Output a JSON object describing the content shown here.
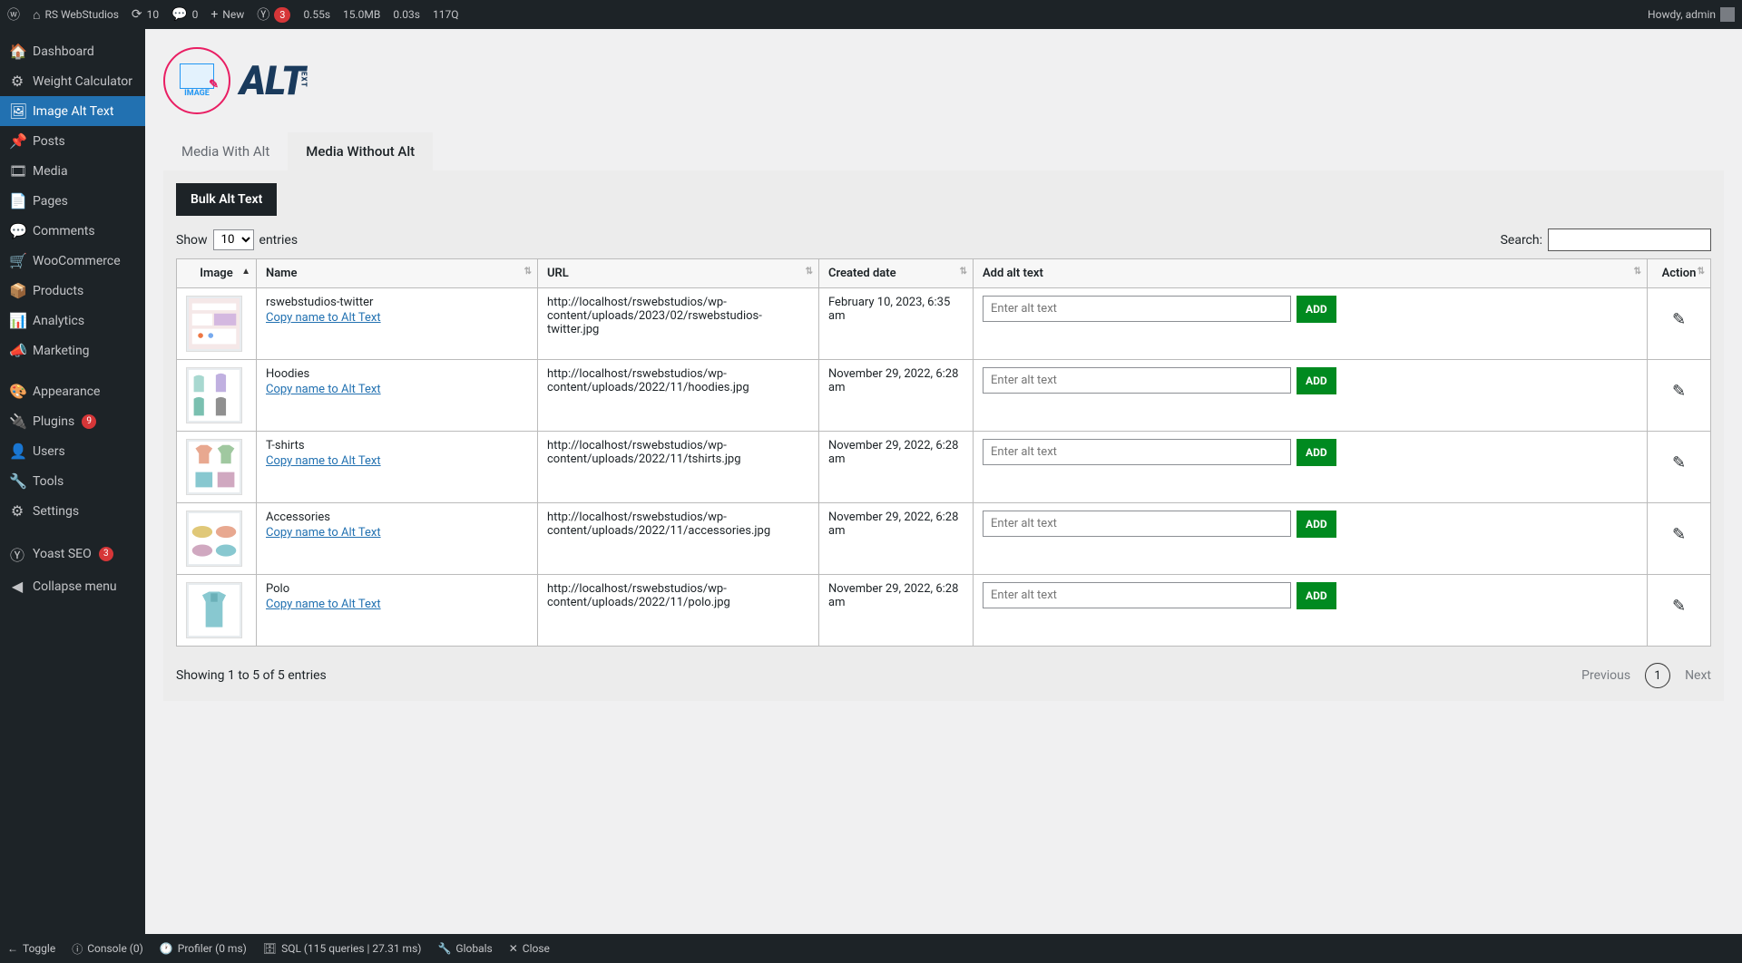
{
  "adminBar": {
    "siteName": "RS WebStudios",
    "refreshCount": "10",
    "commentsCount": "0",
    "newLabel": "New",
    "yoastBadge": "3",
    "perfTime1": "0.55s",
    "perfMem": "15.0MB",
    "perfTime2": "0.03s",
    "perfQ": "117Q",
    "greeting": "Howdy, admin"
  },
  "sidebar": {
    "items": [
      {
        "icon": "speedometer-icon",
        "label": "Dashboard"
      },
      {
        "icon": "gear-icon",
        "label": "Weight Calculator"
      },
      {
        "icon": "image-icon",
        "label": "Image Alt Text",
        "active": true
      },
      {
        "icon": "pin-icon",
        "label": "Posts"
      },
      {
        "icon": "media-icon",
        "label": "Media"
      },
      {
        "icon": "page-icon",
        "label": "Pages"
      },
      {
        "icon": "comment-icon",
        "label": "Comments"
      },
      {
        "icon": "woo-icon",
        "label": "WooCommerce"
      },
      {
        "icon": "product-icon",
        "label": "Products"
      },
      {
        "icon": "analytics-icon",
        "label": "Analytics"
      },
      {
        "icon": "megaphone-icon",
        "label": "Marketing"
      },
      {
        "icon": "brush-icon",
        "label": "Appearance"
      },
      {
        "icon": "plugin-icon",
        "label": "Plugins",
        "badge": "9"
      },
      {
        "icon": "user-icon",
        "label": "Users"
      },
      {
        "icon": "wrench-icon",
        "label": "Tools"
      },
      {
        "icon": "sliders-icon",
        "label": "Settings"
      },
      {
        "icon": "yoast-icon",
        "label": "Yoast SEO",
        "badge": "3"
      },
      {
        "icon": "collapse-icon",
        "label": "Collapse menu"
      }
    ]
  },
  "logo": {
    "circleText": "IMAGE",
    "mainText": "ALT",
    "subText": "TEXT"
  },
  "tabs": {
    "withAlt": "Media With Alt",
    "withoutAlt": "Media Without Alt"
  },
  "bulkBtn": "Bulk Alt Text",
  "controls": {
    "showLabel": "Show",
    "showValue": "10",
    "entriesLabel": "entries",
    "searchLabel": "Search:"
  },
  "columns": {
    "image": "Image",
    "name": "Name",
    "url": "URL",
    "created": "Created date",
    "addAlt": "Add alt text",
    "action": "Action"
  },
  "placeholders": {
    "altInput": "Enter alt text"
  },
  "buttons": {
    "add": "ADD",
    "copyLink": "Copy name to Alt Text"
  },
  "rows": [
    {
      "name": "rswebstudios-twitter",
      "url": "http://localhost/rswebstudios/wp-content/uploads/2023/02/rswebstudios-twitter.jpg",
      "date": "February 10, 2023, 6:35 am",
      "thumb": "twitter"
    },
    {
      "name": "Hoodies",
      "url": "http://localhost/rswebstudios/wp-content/uploads/2022/11/hoodies.jpg",
      "date": "November 29, 2022, 6:28 am",
      "thumb": "hoodies"
    },
    {
      "name": "T-shirts",
      "url": "http://localhost/rswebstudios/wp-content/uploads/2022/11/tshirts.jpg",
      "date": "November 29, 2022, 6:28 am",
      "thumb": "tshirts"
    },
    {
      "name": "Accessories",
      "url": "http://localhost/rswebstudios/wp-content/uploads/2022/11/accessories.jpg",
      "date": "November 29, 2022, 6:28 am",
      "thumb": "accessories"
    },
    {
      "name": "Polo",
      "url": "http://localhost/rswebstudios/wp-content/uploads/2022/11/polo.jpg",
      "date": "November 29, 2022, 6:28 am",
      "thumb": "polo"
    }
  ],
  "pager": {
    "info": "Showing 1 to 5 of 5 entries",
    "prev": "Previous",
    "page": "1",
    "next": "Next"
  },
  "bottomBar": {
    "toggle": "Toggle",
    "console": "Console (0)",
    "profiler": "Profiler (0 ms)",
    "sql": "SQL (115 queries | 27.31 ms)",
    "globals": "Globals",
    "close": "Close"
  }
}
